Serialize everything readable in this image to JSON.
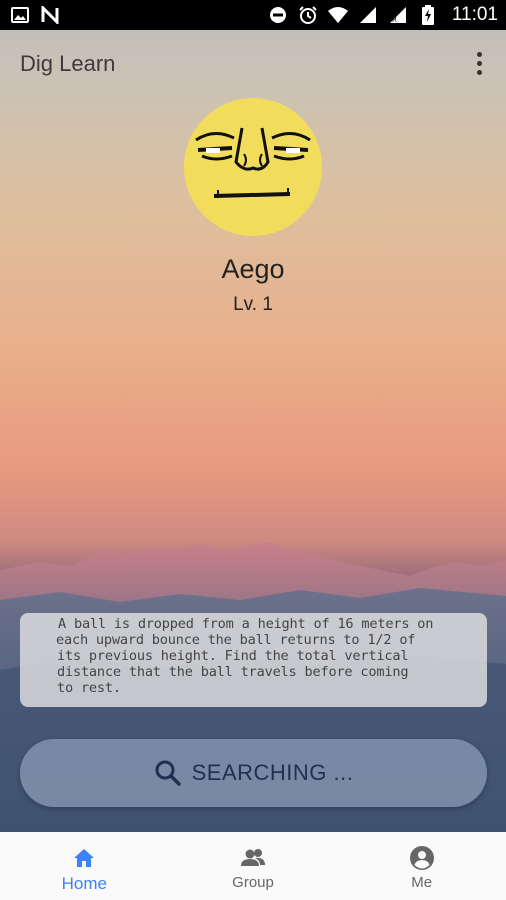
{
  "status_bar": {
    "time": "11:01",
    "left_icons": [
      "image-icon",
      "n-logo-icon"
    ],
    "right_icons": [
      "do-not-disturb-icon",
      "alarm-icon",
      "wifi-icon",
      "cell-signal-icon",
      "cell-signal-r-icon",
      "battery-charging-icon"
    ]
  },
  "app_bar": {
    "title": "Dig Learn",
    "menu_icon": "more-vert-icon"
  },
  "profile": {
    "name": "Aego",
    "level": "Lv. 1",
    "avatar": "meme-face-avatar",
    "avatar_color": "#f2dc5c"
  },
  "question": {
    "lines": [
      "A ball is dropped from a height of 16 meters on",
      "each upward bounce the ball returns to 1/2 of",
      "its previous height. Find the total vertical",
      "distance that the ball travels before coming",
      "to rest."
    ]
  },
  "search_button": {
    "label": "SEARCHING ...",
    "icon": "search-icon"
  },
  "bottom_nav": {
    "items": [
      {
        "label": "Home",
        "icon": "home-icon",
        "active": true
      },
      {
        "label": "Group",
        "icon": "group-icon",
        "active": false
      },
      {
        "label": "Me",
        "icon": "account-circle-icon",
        "active": false
      }
    ],
    "active_color": "#3b82f6"
  }
}
